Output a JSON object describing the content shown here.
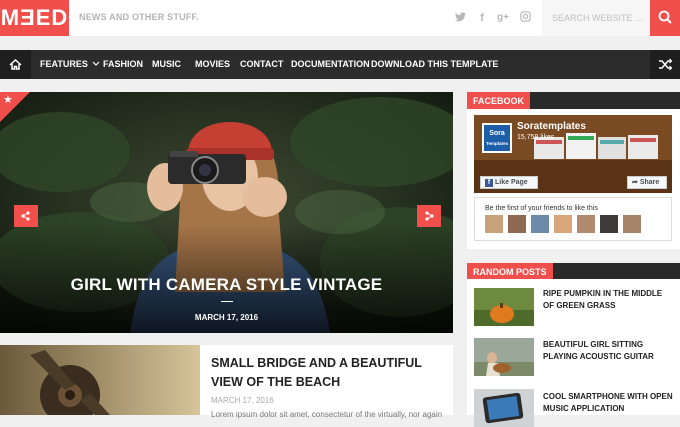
{
  "header": {
    "logo": "MƎED",
    "tagline": "NEWS AND OTHER STUFF.",
    "social_icons": [
      "twitter-icon",
      "facebook-icon",
      "google-plus-icon",
      "instagram-icon"
    ],
    "search_placeholder": "SEARCH WEBSITE ..."
  },
  "nav": {
    "items": [
      "FEATURES",
      "FASHION",
      "MUSIC",
      "MOVIES",
      "CONTACT",
      "DOCUMENTATION",
      "DOWNLOAD THIS TEMPLATE"
    ]
  },
  "slider": {
    "title": "GIRL WITH CAMERA STYLE VINTAGE",
    "date": "MARCH 17, 2016"
  },
  "facebook": {
    "heading": "FACEBOOK",
    "page_name": "Soratemplates",
    "likes": "15,759 likes",
    "logo_text": "Sora",
    "logo_sub": "Templates",
    "like_button": "Like Page",
    "share_button": "Share",
    "friends_text": "Be the first of your friends to like this"
  },
  "random_posts": {
    "heading": "RANDOM POSTS",
    "items": [
      {
        "title": "RIPE PUMPKIN IN THE MIDDLE OF GREEN GRASS"
      },
      {
        "title": "BEAUTIFUL GIRL SITTING PLAYING ACOUSTIC GUITAR"
      },
      {
        "title": "COOL SMARTPHONE WITH OPEN MUSIC APPLICATION"
      }
    ]
  },
  "post": {
    "title": "SMALL BRIDGE AND A BEAUTIFUL VIEW OF THE BEACH",
    "date": "MARCH 17, 2016",
    "excerpt": "Lorem ipsum dolor sit amet, consectetur of the virtually, nor again"
  },
  "colors": {
    "accent": "#f04f4b",
    "nav_bg": "#2c2c2c",
    "page_bg": "#f0f0f0"
  }
}
